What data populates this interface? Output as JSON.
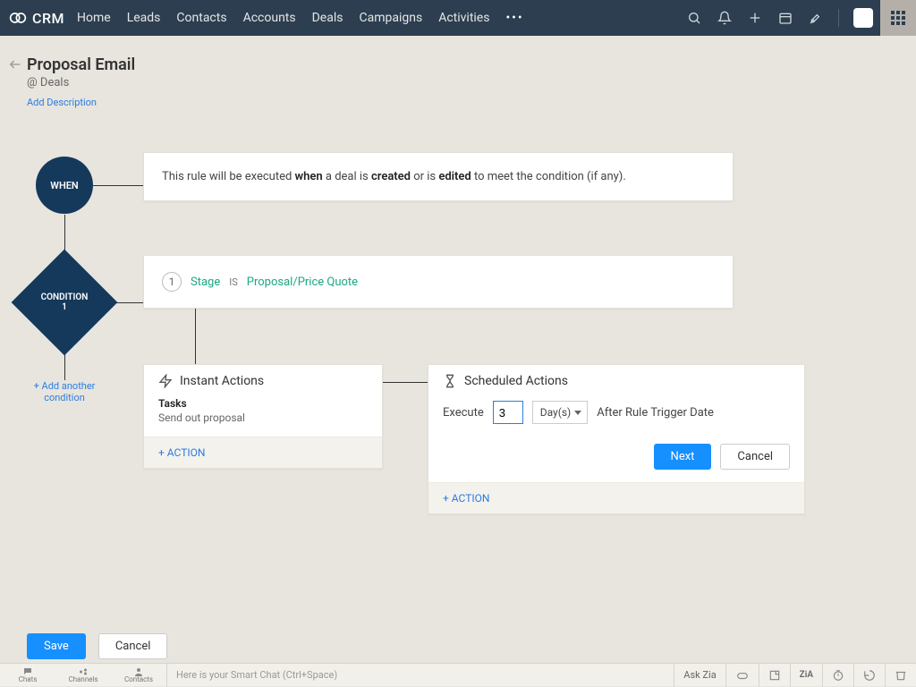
{
  "brand": "CRM",
  "nav": [
    "Home",
    "Leads",
    "Contacts",
    "Accounts",
    "Deals",
    "Campaigns",
    "Activities"
  ],
  "page": {
    "title": "Proposal Email",
    "module_prefix": "@ ",
    "module": "Deals",
    "add_description": "Add Description"
  },
  "when": {
    "node": "WHEN",
    "text_prefix": "This rule will be executed ",
    "b1": "when",
    "mid1": " a deal is ",
    "b2": "created",
    "mid2": " or is ",
    "b3": "edited",
    "suffix": " to meet the condition (if any)."
  },
  "condition": {
    "node_label": "CONDITION",
    "node_num": "1",
    "num": "1",
    "field": "Stage",
    "op": "IS",
    "value": "Proposal/Price Quote",
    "add_another": "+ Add another condition"
  },
  "instant": {
    "title": "Instant Actions",
    "task_label": "Tasks",
    "task_name": "Send out proposal",
    "add_action": "+ ACTION"
  },
  "scheduled": {
    "title": "Scheduled Actions",
    "execute_label": "Execute",
    "value": "3",
    "unit": "Day(s)",
    "after_text": "After Rule Trigger Date",
    "next": "Next",
    "cancel": "Cancel",
    "add_action": "+ ACTION"
  },
  "footer": {
    "save": "Save",
    "cancel": "Cancel"
  },
  "bottombar": {
    "chats": "Chats",
    "channels": "Channels",
    "contacts": "Contacts",
    "smartchat": "Here is your Smart Chat (Ctrl+Space)",
    "askzia": "Ask Zia"
  }
}
